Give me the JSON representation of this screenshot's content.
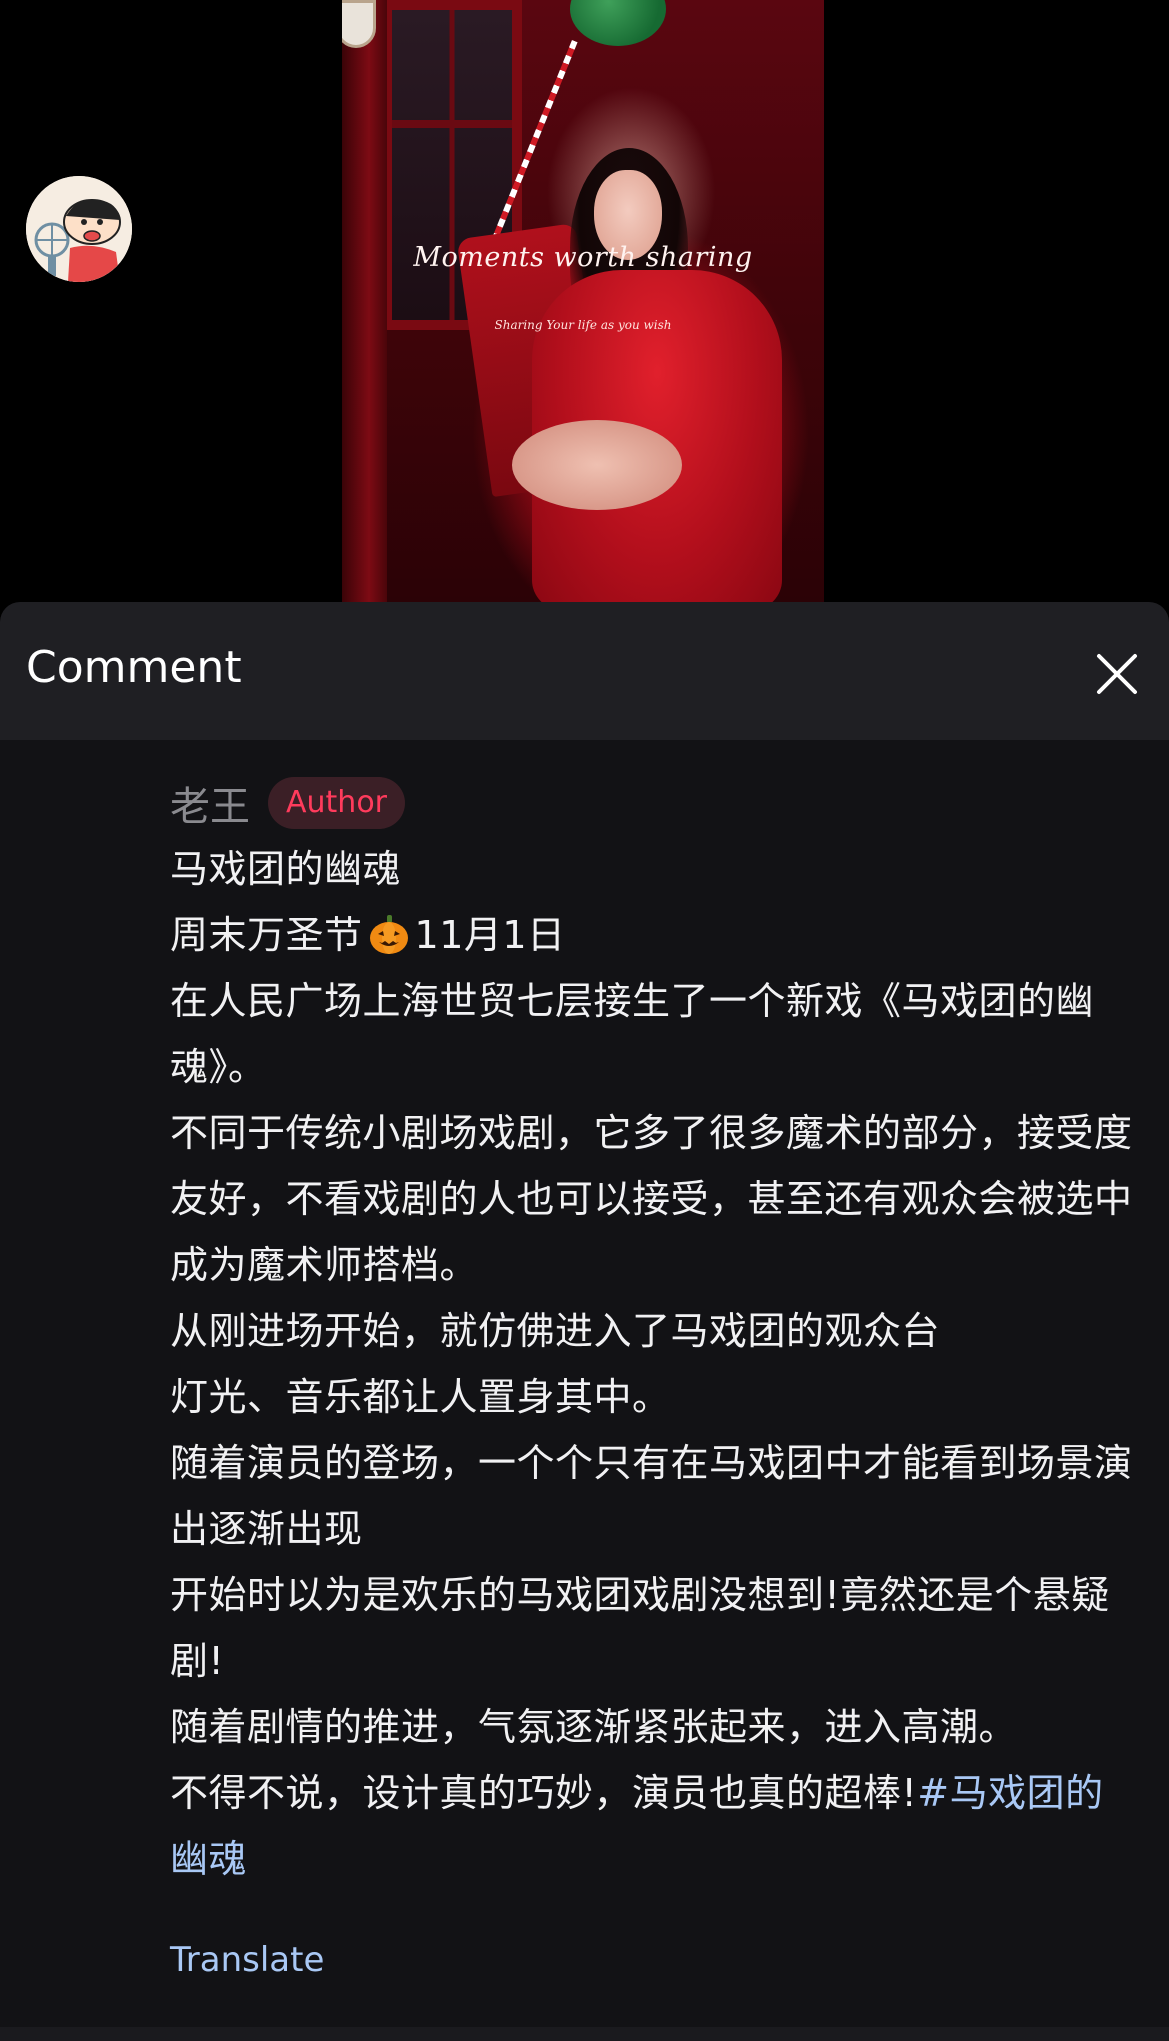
{
  "video": {
    "caption": "Moments worth sharing",
    "subcaption": "Sharing Your life as you wish"
  },
  "sheet": {
    "title": "Comment",
    "close_icon": "close-icon"
  },
  "comment": {
    "author_name": "老王",
    "author_badge": "Author",
    "lines": [
      "马戏团的幽魂",
      "在人民广场上海世贸七层接生了一个新戏《马戏团的幽魂》。",
      "不同于传统小剧场戏剧，它多了很多魔术的部分，接受度友好，不看戏剧的人也可以接受，甚至还有观众会被选中成为魔术师搭档。",
      "从刚进场开始，就仿佛进入了马戏团的观众台",
      "灯光、音乐都让人置身其中。",
      "随着演员的登场，一个个只有在马戏团中才能看到场景演出逐渐出现",
      "开始时以为是欢乐的马戏团戏剧没想到!竟然还是个悬疑剧!",
      "随着剧情的推进，气氛逐渐紧张起来，进入高潮。"
    ],
    "line_weekend_before": "周末万圣节",
    "line_weekend_after": "11月1日",
    "emoji": "pumpkin-emoji",
    "last_line_text": "不得不说，设计真的巧妙，演员也真的超棒!",
    "hashtag": "#马戏团的幽魂",
    "translate_label": "Translate"
  },
  "colors": {
    "sheet_bg": "#121215",
    "header_bg": "#1f1f23",
    "badge_text": "#ff3b5c",
    "link": "#a9c8f5"
  }
}
